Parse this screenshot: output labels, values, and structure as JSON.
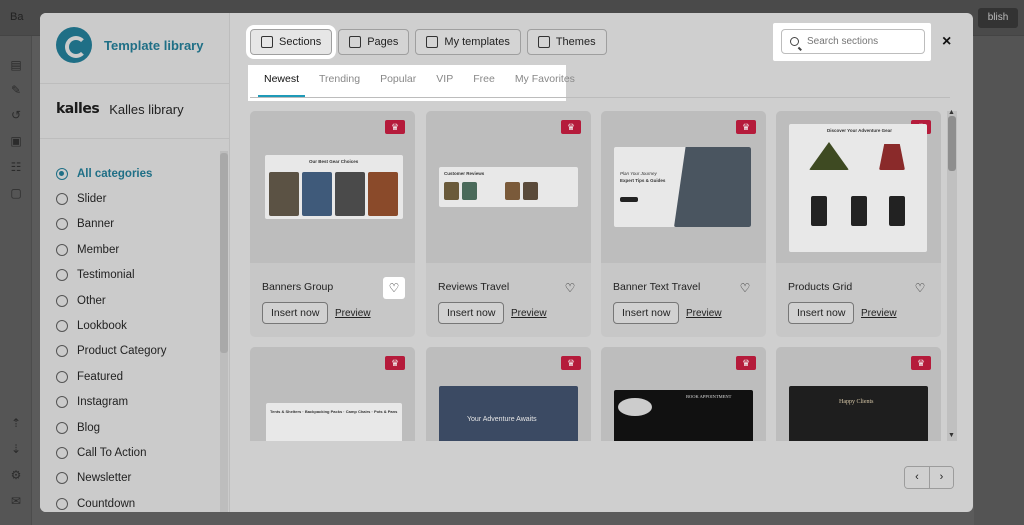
{
  "background": {
    "back_label": "Ba",
    "publish_label": "blish"
  },
  "modal": {
    "logo_title": "Template library",
    "library": {
      "brand": "kalles",
      "title": "Kalles library"
    },
    "categories": [
      {
        "label": "All categories",
        "selected": true
      },
      {
        "label": "Slider",
        "selected": false
      },
      {
        "label": "Banner",
        "selected": false
      },
      {
        "label": "Member",
        "selected": false
      },
      {
        "label": "Testimonial",
        "selected": false
      },
      {
        "label": "Other",
        "selected": false
      },
      {
        "label": "Lookbook",
        "selected": false
      },
      {
        "label": "Product Category",
        "selected": false
      },
      {
        "label": "Featured",
        "selected": false
      },
      {
        "label": "Instagram",
        "selected": false
      },
      {
        "label": "Blog",
        "selected": false
      },
      {
        "label": "Call To Action",
        "selected": false
      },
      {
        "label": "Newsletter",
        "selected": false
      },
      {
        "label": "Countdown",
        "selected": false
      }
    ],
    "toolbar": {
      "sections": "Sections",
      "pages": "Pages",
      "my_templates": "My templates",
      "themes": "Themes"
    },
    "search": {
      "placeholder": "Search sections"
    },
    "close_label": "×",
    "tabs": [
      "Newest",
      "Trending",
      "Popular",
      "VIP",
      "Free",
      "My Favorites"
    ],
    "active_tab": "Newest",
    "cards": [
      {
        "name": "Banners Group",
        "insert": "Insert now",
        "preview": "Preview",
        "thumb_title": "Our Best Gear Choices"
      },
      {
        "name": "Reviews Travel",
        "insert": "Insert now",
        "preview": "Preview",
        "thumb_title": "Customer Reviews"
      },
      {
        "name": "Banner Text Travel",
        "insert": "Insert now",
        "preview": "Preview",
        "thumb_title": "Expert Tips & Guides",
        "thumb_sub": "Plan Your Journey"
      },
      {
        "name": "Products Grid",
        "insert": "Insert now",
        "preview": "Preview",
        "thumb_title": "Discover Your Adventure Gear"
      },
      {
        "name": "",
        "thumb_title": "Tents & Shelters · Backpacking Packs · Camp Chairs · Pots & Pans"
      },
      {
        "name": "",
        "thumb_title": "Your Adventure Awaits"
      },
      {
        "name": "",
        "thumb_title": "BOOK APPOINTMENT"
      },
      {
        "name": "",
        "thumb_title": "Happy Clients"
      }
    ],
    "pager": {
      "prev": "‹",
      "next": "›"
    },
    "colors": {
      "accent": "#1f6f86",
      "tab_underline": "#1f9ab8",
      "premium_badge": "#b51b3b"
    }
  }
}
